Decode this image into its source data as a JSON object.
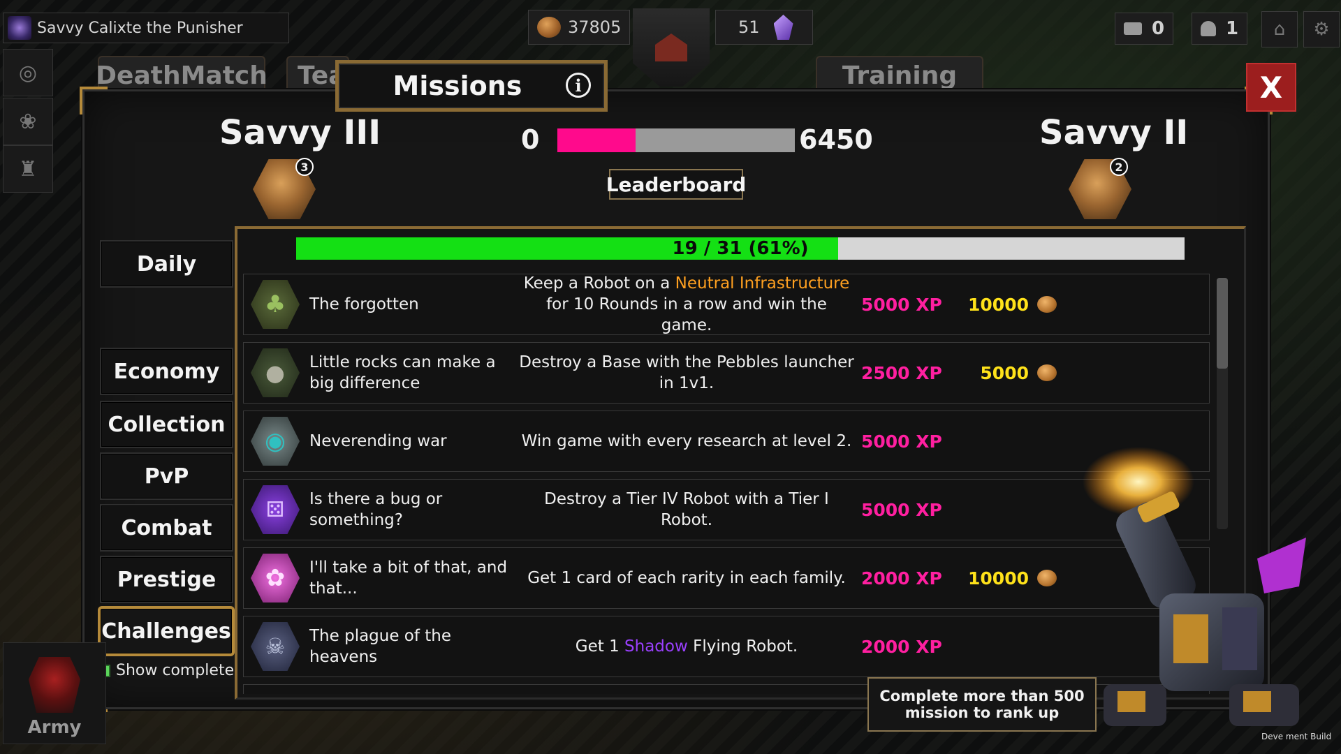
{
  "hud": {
    "player_name": "Savvy Calixte the Punisher",
    "coins": "37805",
    "crystals": "51",
    "messages": "0",
    "friends": "1"
  },
  "background_tabs": [
    "DeathMatch",
    "Tea",
    "Training"
  ],
  "army_label": "Army",
  "dev_build": "Deve  ment Build",
  "missions": {
    "title": "Missions",
    "close_label": "X",
    "current_rank": "Savvy III",
    "current_rank_num": "3",
    "next_rank": "Savvy II",
    "next_rank_num": "2",
    "xp_min": "0",
    "xp_max": "6450",
    "xp_fill_fraction": 0.33,
    "leaderboard_label": "Leaderboard",
    "progress_text": "19 / 31 (61%)",
    "progress_fraction": 0.61,
    "categories": [
      "Daily",
      "Economy",
      "Collection",
      "PvP",
      "Combat",
      "Prestige",
      "Challenges"
    ],
    "active_category": "Challenges",
    "show_completed_label": "Show completed",
    "show_completed_checked": true,
    "tooltip": "Complete more than 500 mission to rank up",
    "list": [
      {
        "name": "The forgotten",
        "desc_pre": "Keep a Robot on a ",
        "desc_highlight": "Neutral Infrastructure",
        "desc_post": " for 10 Rounds in a row and win the game.",
        "xp": "5000 XP",
        "coins": "10000"
      },
      {
        "name": "Little rocks can make a big difference",
        "desc_pre": "Destroy a Base with the Pebbles launcher in 1v1.",
        "desc_highlight": "",
        "desc_post": "",
        "xp": "2500 XP",
        "coins": "5000"
      },
      {
        "name": "Neverending war",
        "desc_pre": "Win game with every research at level 2.",
        "desc_highlight": "",
        "desc_post": "",
        "xp": "5000 XP",
        "coins": ""
      },
      {
        "name": "Is there a bug or something?",
        "desc_pre": "Destroy a Tier IV Robot with a Tier I Robot.",
        "desc_highlight": "",
        "desc_post": "",
        "xp": "5000 XP",
        "coins": ""
      },
      {
        "name": "I'll take a bit of that, and that...",
        "desc_pre": "Get 1 card of each rarity in each family.",
        "desc_highlight": "",
        "desc_post": "",
        "xp": "2000 XP",
        "coins": "10000"
      },
      {
        "name": "The plague of the heavens",
        "desc_pre": "Get 1 ",
        "desc_highlight": "Shadow",
        "desc_post": " Flying Robot.",
        "xp": "2000 XP",
        "coins": ""
      }
    ]
  },
  "colors": {
    "xp": "#ff1fa0",
    "coins": "#ffe21a",
    "progress": "#14e014",
    "xp_bar": "#ff0a8c",
    "close": "#9c1e1e",
    "gold_trim": "#b58a3a",
    "highlight_orange": "#ffa020",
    "highlight_purple": "#9a40ff"
  }
}
